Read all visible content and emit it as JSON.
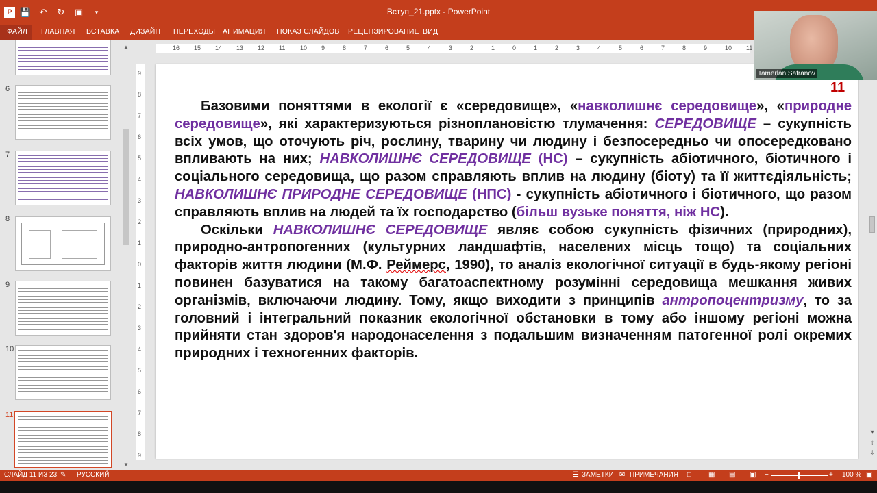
{
  "window": {
    "title": "Вступ_21.pptx - PowerPoint",
    "accent_color": "#c43e1c"
  },
  "quick_access": {
    "save_icon": "save-icon",
    "undo_icon": "undo-icon",
    "redo_icon": "redo-icon",
    "start_icon": "start-slideshow-icon"
  },
  "ribbon": {
    "tabs": [
      "ФАЙЛ",
      "ГЛАВНАЯ",
      "ВСТАВКА",
      "ДИЗАЙН",
      "ПЕРЕХОДЫ",
      "АНИМАЦИЯ",
      "ПОКАЗ СЛАЙДОВ",
      "РЕЦЕНЗИРОВАНИЕ",
      "ВИД"
    ]
  },
  "webcam": {
    "name": "Tamerlan Safranov"
  },
  "thumbnails": {
    "numbers": [
      "6",
      "7",
      "8",
      "9",
      "10",
      "11"
    ],
    "active": "11"
  },
  "ruler": {
    "h_ticks": [
      "16",
      "15",
      "14",
      "13",
      "12",
      "11",
      "10",
      "9",
      "8",
      "7",
      "6",
      "5",
      "4",
      "3",
      "2",
      "1",
      "0",
      "1",
      "2",
      "3",
      "4",
      "5",
      "6",
      "7",
      "8",
      "9",
      "10",
      "11"
    ],
    "v_ticks": [
      "9",
      "8",
      "7",
      "6",
      "5",
      "4",
      "3",
      "2",
      "1",
      "0",
      "1",
      "2",
      "3",
      "4",
      "5",
      "6",
      "7",
      "8",
      "9"
    ]
  },
  "slide": {
    "number": "11",
    "p1": {
      "a": "Базовими поняттями в екології є «середовище», «",
      "b": "навколишнє середовище",
      "c": "», «",
      "d": "природне середовище",
      "e": "», які характеризуються різноплановістю тлумачення: ",
      "f": "СЕРЕДОВИЩЕ",
      "g": " – сукупність всіх умов, що оточують річ, рослину, тварину чи людину і безпосередньо чи опосередковано впливають на них; ",
      "h": "НАВКОЛИШНЄ СЕРЕДОВИЩЕ",
      "i": " (НС)",
      "j": " – сукупність абіотичного, біотичного і соціального середовища, що разом справляють вплив на людину (біоту) та її життєдіяльність; ",
      "k": "НАВКОЛИШНЄ ПРИРОДНЕ  СЕРЕДОВИЩЕ",
      "l": " (НПС)",
      "m": " - сукупність абіотичного і біотичного, що разом справляють вплив на людей та їх господарство (",
      "n": "більш вузьке поняття, ніж НС",
      "o": ")."
    },
    "p2": {
      "a": "Оскільки ",
      "b": "НАВКОЛИШНЄ СЕРЕДОВИЩЕ",
      "c": " являє собою сукупність фізичних (природних), природно-антропогенних (культурних ландшафтів, населених місць тощо) та соціальних факторів життя людини (М.Ф. ",
      "d": "Реймерс",
      "e": ", 1990), то аналіз екологічної ситуації в будь-якому регіоні повинен базуватися на такому багатоаспектному розумінні середовища мешкання живих організмів, включаючи людину. Тому, якщо виходити з принципів ",
      "f": "антропоцентризму",
      "g": ", то за головний і інтегральний показник екологічної обстановки в тому або іншому регіоні можна прийняти стан здоров'я народонаселення з подальшим визначенням патогенної ролі окремих природних і техногенних факторів."
    },
    "text_color": "#111111",
    "term_color": "#7030a0",
    "number_color": "#c00000"
  },
  "status": {
    "slide_info": "СЛАЙД 11 ИЗ 23",
    "language": "РУССКИЙ",
    "notes": "ЗАМЕТКИ",
    "comments": "ПРИМЕЧАНИЯ",
    "zoom": "100 %"
  }
}
